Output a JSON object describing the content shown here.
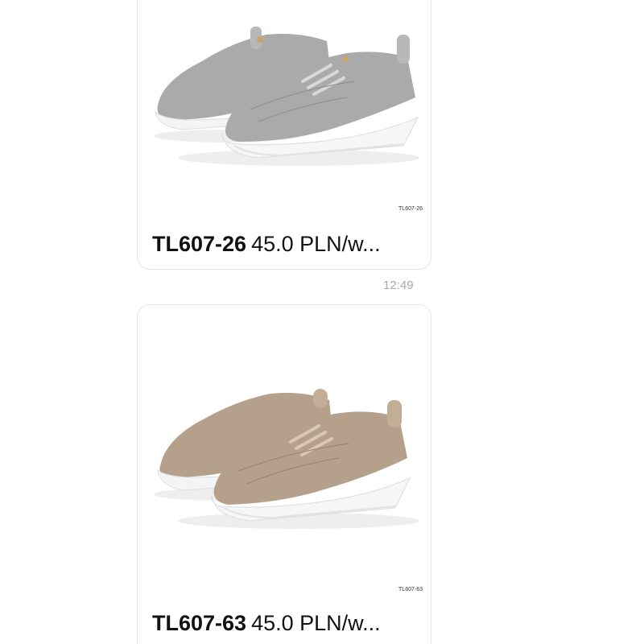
{
  "messages": [
    {
      "image_tag": "TL607-26",
      "product_code": "TL607-26",
      "price_text": "45.0 PLN/w...",
      "shoe_color": "#a9aaa9",
      "shoe_shadow": "#8c8d8c"
    },
    {
      "image_tag": "TL607-63",
      "product_code": "TL607-63",
      "price_text": "45.0 PLN/w...",
      "shoe_color": "#b4a08b",
      "shoe_shadow": "#98826c"
    }
  ],
  "timestamp": "12:49"
}
